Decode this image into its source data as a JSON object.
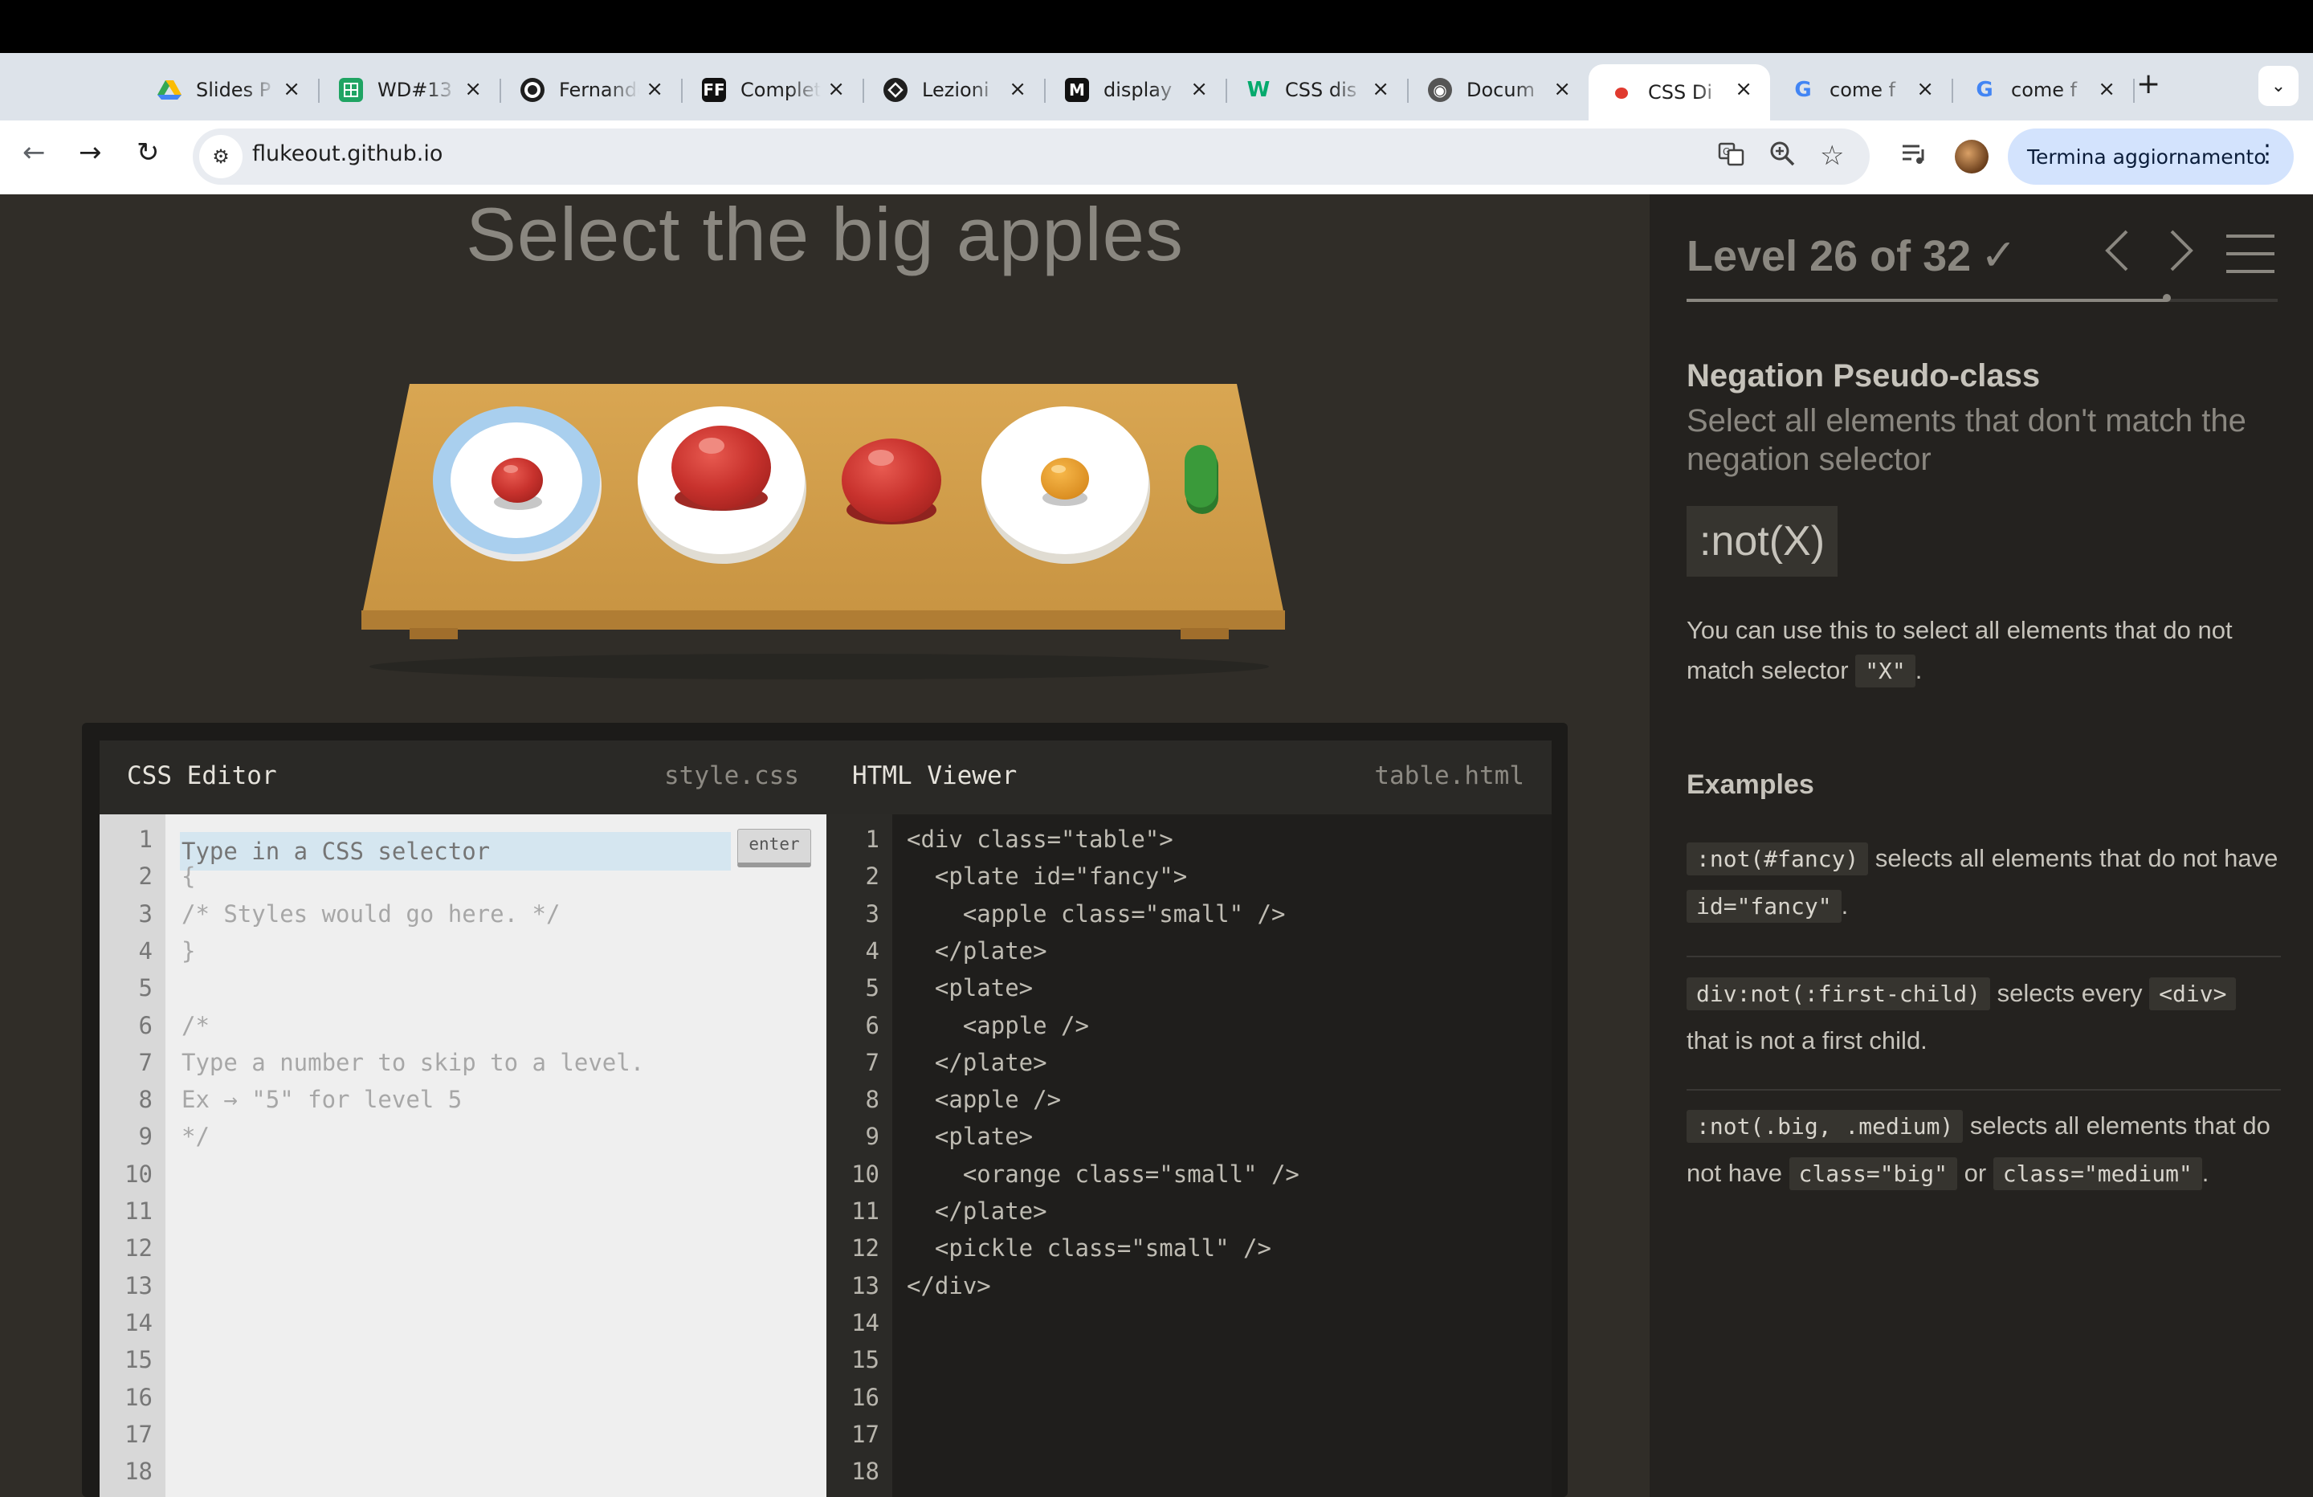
{
  "browser": {
    "tabs": [
      {
        "title": "Slides P",
        "icon": "google-drive-icon",
        "active": false
      },
      {
        "title": "WD#13",
        "icon": "google-sheets-icon",
        "active": false
      },
      {
        "title": "Fernando",
        "icon": "github-icon",
        "active": false
      },
      {
        "title": "Complete",
        "icon": "ff-icon",
        "active": false
      },
      {
        "title": "Lezioni",
        "icon": "lezioni-icon",
        "active": false
      },
      {
        "title": "display",
        "icon": "mdn-icon",
        "active": false
      },
      {
        "title": "CSS dis",
        "icon": "w3schools-icon",
        "active": false
      },
      {
        "title": "Docum",
        "icon": "globe-icon",
        "active": false
      },
      {
        "title": "CSS Di",
        "icon": "flukeout-icon",
        "active": true
      },
      {
        "title": "come f",
        "icon": "google-icon",
        "active": false
      },
      {
        "title": "come f",
        "icon": "google-icon",
        "active": false
      }
    ],
    "new_tab": "+",
    "tab_menu": "⌄",
    "url": "flukeout.github.io",
    "update_button": "Termina aggiornamento"
  },
  "game": {
    "instruction": "Select the big apples"
  },
  "css_editor": {
    "title": "CSS Editor",
    "file": "style.css",
    "input_placeholder": "Type in a CSS selector",
    "enter_label": "enter",
    "lines": [
      "{",
      "/* Styles would go here. */",
      "}",
      "",
      "/*",
      "Type a number to skip to a level.",
      "Ex → \"5\" for level 5",
      "*/"
    ],
    "line_numbers": [
      "1",
      "2",
      "3",
      "4",
      "5",
      "6",
      "7",
      "8",
      "9",
      "10",
      "11",
      "12",
      "13",
      "14",
      "15",
      "16",
      "17",
      "18"
    ]
  },
  "html_viewer": {
    "title": "HTML Viewer",
    "file": "table.html",
    "lines": [
      "<div class=\"table\">",
      "  <plate id=\"fancy\">",
      "    <apple class=\"small\" />",
      "  </plate>",
      "  <plate>",
      "    <apple />",
      "  </plate>",
      "  <apple />",
      "  <plate>",
      "    <orange class=\"small\" />",
      "  </plate>",
      "  <pickle class=\"small\" />",
      "</div>"
    ],
    "line_numbers": [
      "1",
      "2",
      "3",
      "4",
      "5",
      "6",
      "7",
      "8",
      "9",
      "10",
      "11",
      "12",
      "13",
      "14",
      "15",
      "16",
      "17",
      "18"
    ]
  },
  "sidebar": {
    "level_text": "Level 26 of 32",
    "level_current": 26,
    "level_total": 32,
    "check": "✓",
    "selector_name": "Negation Pseudo-class",
    "selector_title": "Select all elements that don't match the negation selector",
    "syntax": ":not(X)",
    "hint_before": "You can use this to select all elements that do not match selector",
    "hint_code": "\"X\"",
    "hint_after": ".",
    "examples_title": "Examples",
    "examples": [
      {
        "code1": ":not(#fancy)",
        "text1": " selects all elements that do not have ",
        "code2": "id=\"fancy\"",
        "text2": ".",
        "code3": "",
        "text3": ""
      },
      {
        "code1": "div:not(:first-child)",
        "text1": " selects every ",
        "code2": "<div>",
        "text2": " that is not a first child.",
        "code3": "",
        "text3": ""
      },
      {
        "code1": ":not(.big, .medium)",
        "text1": " selects all elements that do not have ",
        "code2": "class=\"big\"",
        "text2": " or ",
        "code3": "class=\"medium\"",
        "text3": "."
      }
    ]
  },
  "colors": {
    "game_bg": "#302d28",
    "sidebar_bg": "#24221f",
    "table_wood": "#d39f47",
    "apple_red": "#c8322d",
    "orange": "#e89a2c",
    "pickle_green": "#3a9a3a",
    "fancy_plate_blue": "#a9cfee"
  }
}
